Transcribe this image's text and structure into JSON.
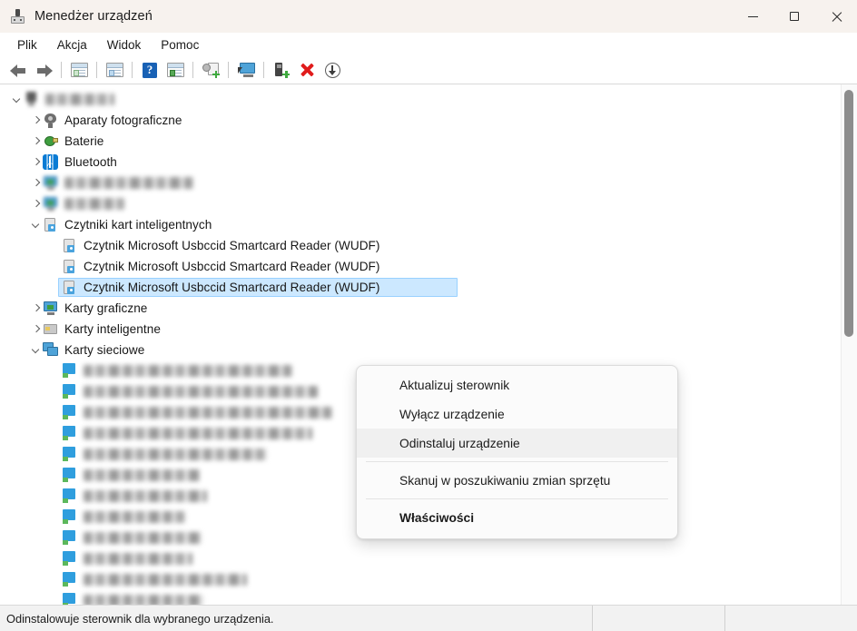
{
  "window": {
    "title": "Menedżer urządzeń",
    "app_icon": "device-manager-icon",
    "controls": {
      "minimize": "minimize-icon",
      "maximize": "maximize-icon",
      "close": "close-icon"
    }
  },
  "menubar": {
    "items": [
      {
        "label": "Plik"
      },
      {
        "label": "Akcja"
      },
      {
        "label": "Widok"
      },
      {
        "label": "Pomoc"
      }
    ]
  },
  "toolbar": {
    "buttons": [
      {
        "name": "back-arrow-icon",
        "tooltip": "Wstecz"
      },
      {
        "name": "forward-arrow-icon",
        "tooltip": "Dalej"
      },
      {
        "name": "show-hide-console-tree-icon",
        "tooltip": "Pokaż/ukryj drzewo konsoli"
      },
      {
        "name": "properties-window-icon",
        "tooltip": "Właściwości"
      },
      {
        "name": "help-icon",
        "tooltip": "Pomoc"
      },
      {
        "name": "show-hide-action-pane-icon",
        "tooltip": "Pokaż/ukryj okienko akcji"
      },
      {
        "name": "update-driver-icon",
        "tooltip": "Aktualizuj sterownik"
      },
      {
        "name": "scan-hardware-changes-icon",
        "tooltip": "Skanuj w poszukiwaniu zmian sprzętu"
      },
      {
        "name": "enable-device-icon",
        "tooltip": "Włącz urządzenie"
      },
      {
        "name": "uninstall-device-icon",
        "tooltip": "Odinstaluj urządzenie"
      },
      {
        "name": "disable-device-icon",
        "tooltip": "Wyłącz urządzenie"
      }
    ]
  },
  "tree": {
    "rows": [
      {
        "indent": 0,
        "twisty": "open",
        "icon": "computer-icon",
        "icon_blurred": true,
        "label": "",
        "redacted": true,
        "redacted_width": 76,
        "selected": false
      },
      {
        "indent": 1,
        "twisty": "closed",
        "icon": "camera-icon",
        "icon_blurred": false,
        "label": "Aparaty fotograficzne",
        "redacted": false,
        "selected": false
      },
      {
        "indent": 1,
        "twisty": "closed",
        "icon": "battery-icon",
        "icon_blurred": false,
        "label": "Baterie",
        "redacted": false,
        "selected": false
      },
      {
        "indent": 1,
        "twisty": "closed",
        "icon": "bluetooth-icon",
        "icon_blurred": false,
        "label": "Bluetooth",
        "redacted": false,
        "selected": false
      },
      {
        "indent": 1,
        "twisty": "closed",
        "icon": "generic-device-icon",
        "icon_blurred": true,
        "label": "",
        "redacted": true,
        "redacted_width": 142,
        "selected": false
      },
      {
        "indent": 1,
        "twisty": "closed",
        "icon": "generic-device-icon",
        "icon_blurred": true,
        "label": "",
        "redacted": true,
        "redacted_width": 66,
        "selected": false
      },
      {
        "indent": 1,
        "twisty": "open",
        "icon": "smartcard-reader-icon",
        "icon_blurred": false,
        "label": "Czytniki kart inteligentnych",
        "redacted": false,
        "selected": false
      },
      {
        "indent": 2,
        "twisty": "none",
        "icon": "smartcard-reader-icon",
        "icon_blurred": false,
        "label": "Czytnik Microsoft Usbccid Smartcard Reader (WUDF)",
        "redacted": false,
        "selected": false
      },
      {
        "indent": 2,
        "twisty": "none",
        "icon": "smartcard-reader-icon",
        "icon_blurred": false,
        "label": "Czytnik Microsoft Usbccid Smartcard Reader (WUDF)",
        "redacted": false,
        "selected": false
      },
      {
        "indent": 2,
        "twisty": "none",
        "icon": "smartcard-reader-icon",
        "icon_blurred": false,
        "label": "Czytnik Microsoft Usbccid Smartcard Reader (WUDF)",
        "redacted": false,
        "selected": true
      },
      {
        "indent": 1,
        "twisty": "closed",
        "icon": "display-adapter-icon",
        "icon_blurred": false,
        "label": "Karty graficzne",
        "redacted": false,
        "selected": false
      },
      {
        "indent": 1,
        "twisty": "closed",
        "icon": "smartcard-icon",
        "icon_blurred": false,
        "label": "Karty inteligentne",
        "redacted": false,
        "selected": false
      },
      {
        "indent": 1,
        "twisty": "open",
        "icon": "network-adapter-group-icon",
        "icon_blurred": false,
        "label": "Karty sieciowe",
        "redacted": false,
        "selected": false
      },
      {
        "indent": 2,
        "twisty": "none",
        "icon": "network-adapter-icon",
        "icon_blurred": false,
        "label": "",
        "redacted": true,
        "redacted_width": 230,
        "selected": false
      },
      {
        "indent": 2,
        "twisty": "none",
        "icon": "network-adapter-icon",
        "icon_blurred": false,
        "label": "",
        "redacted": true,
        "redacted_width": 258,
        "selected": false
      },
      {
        "indent": 2,
        "twisty": "none",
        "icon": "network-adapter-icon",
        "icon_blurred": false,
        "label": "",
        "redacted": true,
        "redacted_width": 274,
        "selected": false
      },
      {
        "indent": 2,
        "twisty": "none",
        "icon": "network-adapter-icon",
        "icon_blurred": false,
        "label": "",
        "redacted": true,
        "redacted_width": 252,
        "selected": false
      },
      {
        "indent": 2,
        "twisty": "none",
        "icon": "network-adapter-icon",
        "icon_blurred": false,
        "label": "",
        "redacted": true,
        "redacted_width": 202,
        "selected": false
      },
      {
        "indent": 2,
        "twisty": "none",
        "icon": "network-adapter-icon",
        "icon_blurred": false,
        "label": "",
        "redacted": true,
        "redacted_width": 128,
        "selected": false
      },
      {
        "indent": 2,
        "twisty": "none",
        "icon": "network-adapter-icon",
        "icon_blurred": false,
        "label": "",
        "redacted": true,
        "redacted_width": 136,
        "selected": false
      },
      {
        "indent": 2,
        "twisty": "none",
        "icon": "network-adapter-icon",
        "icon_blurred": false,
        "label": "",
        "redacted": true,
        "redacted_width": 112,
        "selected": false
      },
      {
        "indent": 2,
        "twisty": "none",
        "icon": "network-adapter-icon",
        "icon_blurred": false,
        "label": "",
        "redacted": true,
        "redacted_width": 130,
        "selected": false
      },
      {
        "indent": 2,
        "twisty": "none",
        "icon": "network-adapter-icon",
        "icon_blurred": false,
        "label": "",
        "redacted": true,
        "redacted_width": 120,
        "selected": false
      },
      {
        "indent": 2,
        "twisty": "none",
        "icon": "network-adapter-icon",
        "icon_blurred": false,
        "label": "",
        "redacted": true,
        "redacted_width": 180,
        "selected": false
      },
      {
        "indent": 2,
        "twisty": "none",
        "icon": "network-adapter-icon",
        "icon_blurred": false,
        "label": "",
        "redacted": true,
        "redacted_width": 132,
        "selected": false
      },
      {
        "indent": 2,
        "twisty": "none",
        "icon": "network-adapter-icon",
        "icon_blurred": false,
        "label": "",
        "redacted": true,
        "redacted_width": 150,
        "selected": false
      }
    ]
  },
  "context_menu": {
    "items": [
      {
        "label": "Aktualizuj sterownik",
        "bold": false,
        "separator_after": false,
        "hover": false
      },
      {
        "label": "Wyłącz urządzenie",
        "bold": false,
        "separator_after": false,
        "hover": false
      },
      {
        "label": "Odinstaluj urządzenie",
        "bold": false,
        "separator_after": true,
        "hover": true
      },
      {
        "label": "Skanuj w poszukiwaniu zmian sprzętu",
        "bold": false,
        "separator_after": true,
        "hover": false
      },
      {
        "label": "Właściwości",
        "bold": true,
        "separator_after": false,
        "hover": false
      }
    ],
    "highlight_color": "#e21313"
  },
  "statusbar": {
    "message": "Odinstalowuje sterownik dla wybranego urządzenia."
  },
  "colors": {
    "titlebar_bg": "#f7f2ee",
    "selection_bg": "#cce8ff",
    "selection_border": "#99d1ff",
    "accent_red": "#e21313",
    "statusbar_bg": "#f2f2f2"
  }
}
